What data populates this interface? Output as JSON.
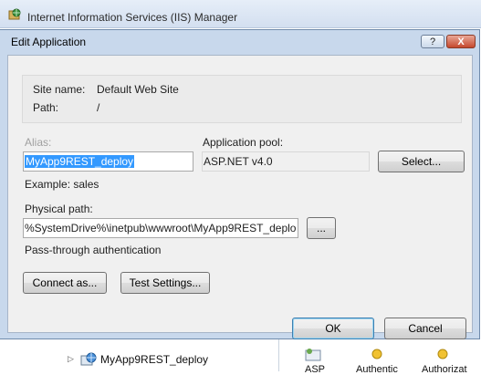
{
  "window": {
    "title": "Internet Information Services (IIS) Manager"
  },
  "dialog": {
    "title": "Edit Application",
    "help_label": "?",
    "close_label": "X",
    "site_name_label": "Site name:",
    "site_name_value": "Default Web Site",
    "path_label": "Path:",
    "path_value": "/",
    "alias_label": "Alias:",
    "alias_value": "MyApp9REST_deploy",
    "alias_example": "Example: sales",
    "app_pool_label": "Application pool:",
    "app_pool_value": "ASP.NET v4.0",
    "select_button": "Select...",
    "physical_path_label": "Physical path:",
    "physical_path_value": "%SystemDrive%\\inetpub\\wwwroot\\MyApp9REST_deplo",
    "browse_button": "...",
    "passthrough_label": "Pass-through authentication",
    "connect_as_button": "Connect as...",
    "test_settings_button": "Test Settings...",
    "ok_button": "OK",
    "cancel_button": "Cancel"
  },
  "tree": {
    "node_label": "MyApp9REST_deploy",
    "node_icon": "web-application-icon"
  },
  "features": [
    {
      "label": "ASP",
      "icon": "asp-icon"
    },
    {
      "label": "Authentic",
      "icon": "authentication-icon"
    },
    {
      "label": "Authorizat",
      "icon": "authorization-icon"
    }
  ]
}
